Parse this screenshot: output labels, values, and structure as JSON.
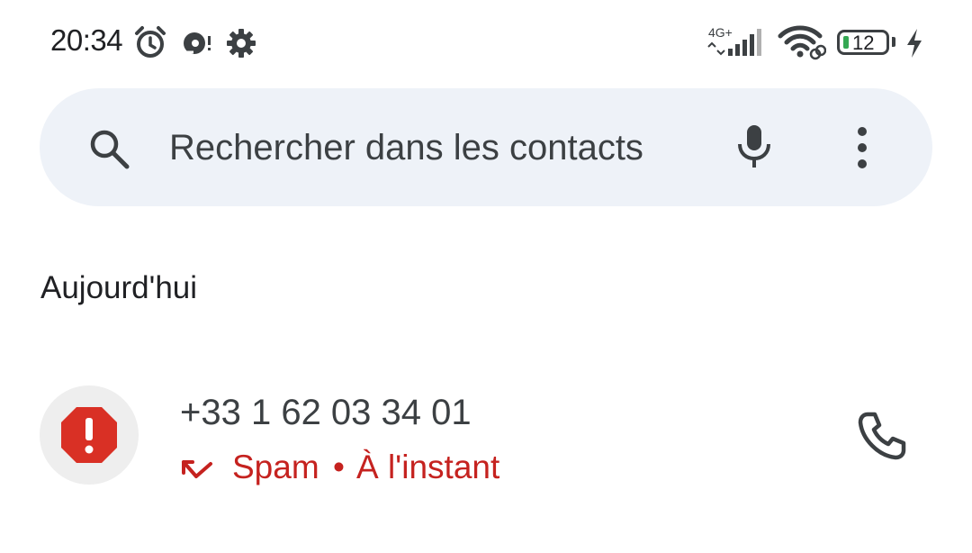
{
  "status_bar": {
    "time": "20:34",
    "network_type": "4G+",
    "battery_level": "12",
    "icons": [
      "alarm-icon",
      "notification-icon",
      "settings-icon",
      "signal-icon",
      "wifi-icon",
      "battery-icon",
      "charging-icon"
    ]
  },
  "search": {
    "placeholder": "Rechercher dans les contacts",
    "icons": [
      "search-icon",
      "mic-icon",
      "more-vert-icon"
    ]
  },
  "section": {
    "title": "Aujourd'hui"
  },
  "calls": [
    {
      "number": "+33 1 62 03 34 01",
      "label": "Spam",
      "separator": "•",
      "time": "À l'instant",
      "icons": [
        "spam-warning-icon",
        "missed-call-icon",
        "phone-icon"
      ]
    }
  ],
  "colors": {
    "accent_red": "#c5221f",
    "search_bg": "#eef2f8",
    "avatar_bg": "#eeeeee",
    "battery_green": "#34a853"
  }
}
